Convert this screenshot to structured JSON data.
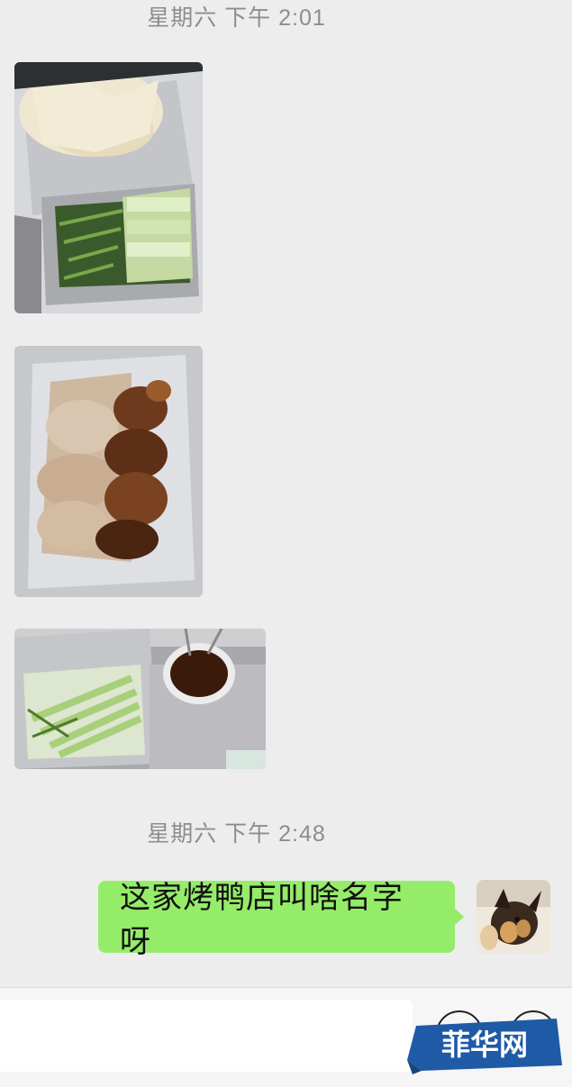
{
  "timestamps": [
    "星期六 下午 2:01",
    "星期六 下午 2:48"
  ],
  "messages": [
    {
      "type": "image",
      "side": "left",
      "content": "pancakes, scallions and cucumber on foil"
    },
    {
      "type": "image",
      "side": "left",
      "content": "sliced roast duck on foil"
    },
    {
      "type": "image",
      "side": "left",
      "content": "cucumber strips and dipping sauce bowl"
    },
    {
      "type": "text",
      "side": "right",
      "text": "这家烤鸭店叫啥名字呀"
    }
  ],
  "input": {
    "value": "",
    "emoji_icon": "emoji-icon",
    "plus_icon": "plus-icon"
  },
  "watermark": {
    "text": "菲华网"
  },
  "colors": {
    "background": "#ededed",
    "bubble_sent": "#95ec69",
    "timestamp": "#8d8d8d",
    "watermark": "#1f5aa6"
  }
}
